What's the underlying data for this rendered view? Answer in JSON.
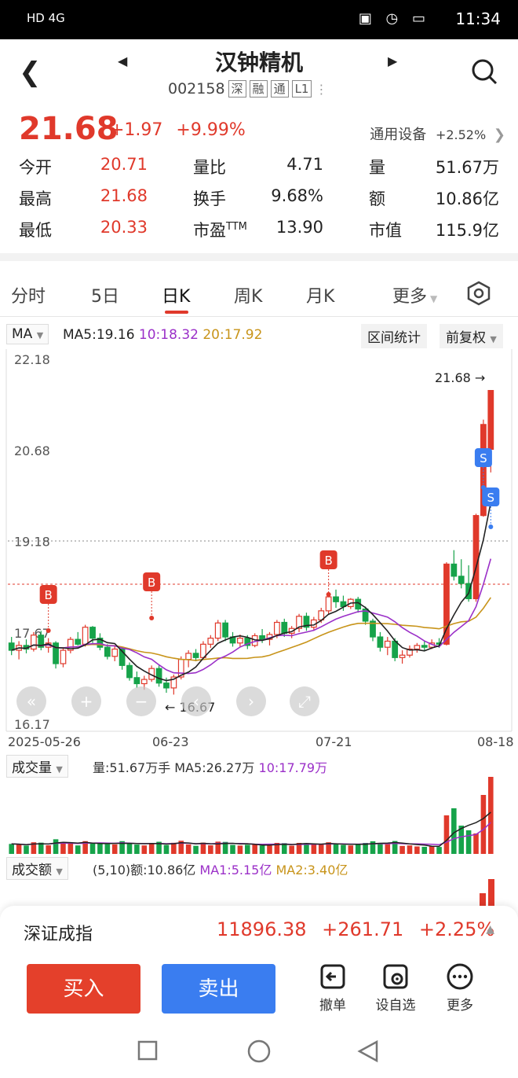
{
  "status_bar": {
    "left": "HD 4G",
    "time": "11:34"
  },
  "header": {
    "title": "汉钟精机",
    "code": "002158",
    "tags": [
      "深",
      "融",
      "通",
      "L1"
    ]
  },
  "quote": {
    "price": "21.68",
    "change": "+1.97",
    "change_pct": "+9.99%",
    "sector": {
      "name": "通用设备",
      "pct": "+2.52%"
    },
    "stats": [
      {
        "label": "今开",
        "value": "20.71",
        "red": true
      },
      {
        "label": "量比",
        "value": "4.71",
        "red": false
      },
      {
        "label": "量",
        "value": "51.67万",
        "red": false
      },
      {
        "label": "最高",
        "value": "21.68",
        "red": true
      },
      {
        "label": "换手",
        "value": "9.68%",
        "red": false
      },
      {
        "label": "额",
        "value": "10.86亿",
        "red": false
      },
      {
        "label": "最低",
        "value": "20.33",
        "red": true
      },
      {
        "label": "市盈TTM",
        "value": "13.90",
        "red": false
      },
      {
        "label": "市值",
        "value": "115.9亿",
        "red": false
      }
    ]
  },
  "tabs": [
    "分时",
    "5日",
    "日K",
    "周K",
    "月K",
    "更多"
  ],
  "active_tab": "日K",
  "ma_bar": {
    "selector": "MA",
    "ma5": "MA5:19.16",
    "ma10": "10:18.32",
    "ma20": "20:17.92",
    "range_stats": "区间统计",
    "adjust": "前复权"
  },
  "colors": {
    "up": "#e0392b",
    "down": "#16a34a",
    "ma5": "#222222",
    "ma10": "#9b30c8",
    "ma20": "#c8941a",
    "blue": "#3a7df0"
  },
  "chart_data": {
    "type": "candlestick",
    "y_ticks": [
      "22.18",
      "20.68",
      "19.18",
      "17.67",
      "16.17"
    ],
    "ylim": [
      16.17,
      22.18
    ],
    "x_ticks": [
      "2025-05-26",
      "06-23",
      "07-21",
      "08-18"
    ],
    "latest_label": "21.68",
    "low_label": "16.67",
    "markers": [
      "B",
      "B",
      "B",
      "S",
      "S"
    ],
    "candles": [
      [
        17.52,
        17.62,
        17.32,
        17.4
      ],
      [
        17.4,
        17.55,
        17.25,
        17.48
      ],
      [
        17.48,
        17.58,
        17.35,
        17.42
      ],
      [
        17.42,
        17.7,
        17.38,
        17.65
      ],
      [
        17.65,
        17.72,
        17.4,
        17.45
      ],
      [
        17.45,
        17.6,
        17.36,
        17.52
      ],
      [
        17.52,
        17.55,
        17.1,
        17.18
      ],
      [
        17.18,
        17.45,
        17.12,
        17.4
      ],
      [
        17.4,
        17.62,
        17.35,
        17.58
      ],
      [
        17.58,
        17.7,
        17.48,
        17.5
      ],
      [
        17.5,
        17.82,
        17.46,
        17.78
      ],
      [
        17.78,
        17.8,
        17.52,
        17.6
      ],
      [
        17.6,
        17.68,
        17.4,
        17.45
      ],
      [
        17.45,
        17.5,
        17.25,
        17.3
      ],
      [
        17.3,
        17.48,
        17.22,
        17.42
      ],
      [
        17.42,
        17.45,
        17.08,
        17.15
      ],
      [
        17.15,
        17.2,
        16.9,
        16.95
      ],
      [
        16.95,
        17.05,
        16.78,
        16.85
      ],
      [
        16.85,
        16.98,
        16.75,
        16.92
      ],
      [
        16.92,
        17.15,
        16.88,
        17.1
      ],
      [
        17.1,
        17.15,
        16.8,
        16.86
      ],
      [
        16.86,
        16.95,
        16.7,
        16.78
      ],
      [
        16.78,
        17.0,
        16.67,
        16.96
      ],
      [
        16.96,
        17.3,
        16.92,
        17.25
      ],
      [
        17.25,
        17.4,
        17.12,
        17.35
      ],
      [
        17.35,
        17.42,
        17.22,
        17.28
      ],
      [
        17.28,
        17.55,
        17.25,
        17.5
      ],
      [
        17.5,
        17.65,
        17.44,
        17.6
      ],
      [
        17.6,
        17.9,
        17.55,
        17.85
      ],
      [
        17.85,
        17.9,
        17.55,
        17.62
      ],
      [
        17.62,
        17.7,
        17.46,
        17.52
      ],
      [
        17.52,
        17.66,
        17.45,
        17.6
      ],
      [
        17.6,
        17.65,
        17.42,
        17.48
      ],
      [
        17.48,
        17.68,
        17.45,
        17.64
      ],
      [
        17.64,
        17.75,
        17.52,
        17.58
      ],
      [
        17.58,
        17.7,
        17.48,
        17.66
      ],
      [
        17.66,
        17.9,
        17.6,
        17.86
      ],
      [
        17.86,
        17.92,
        17.62,
        17.68
      ],
      [
        17.68,
        17.8,
        17.6,
        17.76
      ],
      [
        17.76,
        18.0,
        17.7,
        17.96
      ],
      [
        17.96,
        18.02,
        17.72,
        17.78
      ],
      [
        17.78,
        17.95,
        17.72,
        17.9
      ],
      [
        17.9,
        18.1,
        17.85,
        18.05
      ],
      [
        18.05,
        18.32,
        18.0,
        18.28
      ],
      [
        18.28,
        18.4,
        18.1,
        18.2
      ],
      [
        18.2,
        18.3,
        18.05,
        18.12
      ],
      [
        18.12,
        18.26,
        18.08,
        18.24
      ],
      [
        18.24,
        18.28,
        18.02,
        18.08
      ],
      [
        18.08,
        18.12,
        17.82,
        17.88
      ],
      [
        17.88,
        17.92,
        17.55,
        17.62
      ],
      [
        17.62,
        17.7,
        17.38,
        17.45
      ],
      [
        17.45,
        17.62,
        17.32,
        17.55
      ],
      [
        17.55,
        17.6,
        17.22,
        17.28
      ],
      [
        17.28,
        17.4,
        17.18,
        17.32
      ],
      [
        17.32,
        17.48,
        17.28,
        17.42
      ],
      [
        17.42,
        17.52,
        17.36,
        17.48
      ],
      [
        17.48,
        17.56,
        17.4,
        17.45
      ],
      [
        17.45,
        17.58,
        17.42,
        17.52
      ],
      [
        17.52,
        17.6,
        17.44,
        17.5
      ],
      [
        17.5,
        18.85,
        17.48,
        18.82
      ],
      [
        18.82,
        19.05,
        18.55,
        18.62
      ],
      [
        18.62,
        18.9,
        18.42,
        18.5
      ],
      [
        18.5,
        18.8,
        18.2,
        18.25
      ],
      [
        18.25,
        19.65,
        18.2,
        19.62
      ],
      [
        19.62,
        21.2,
        19.6,
        21.12
      ],
      [
        20.71,
        21.68,
        20.33,
        21.68
      ]
    ]
  },
  "volume": {
    "selector": "成交量",
    "text_main": "量:51.67万手 MA5:26.27万",
    "text_ma10": "10:17.79万"
  },
  "amount": {
    "selector": "成交额",
    "text_main": "(5,10)额:10.86亿",
    "text_ma1": "MA1:5.15亿",
    "text_ma2": "MA2:3.40亿"
  },
  "index_bar": {
    "name": "深证成指",
    "value": "11896.38",
    "change": "+261.71",
    "pct": "+2.25%"
  },
  "actions": {
    "buy": "买入",
    "sell": "卖出",
    "items": [
      "撤单",
      "设自选",
      "更多"
    ]
  }
}
